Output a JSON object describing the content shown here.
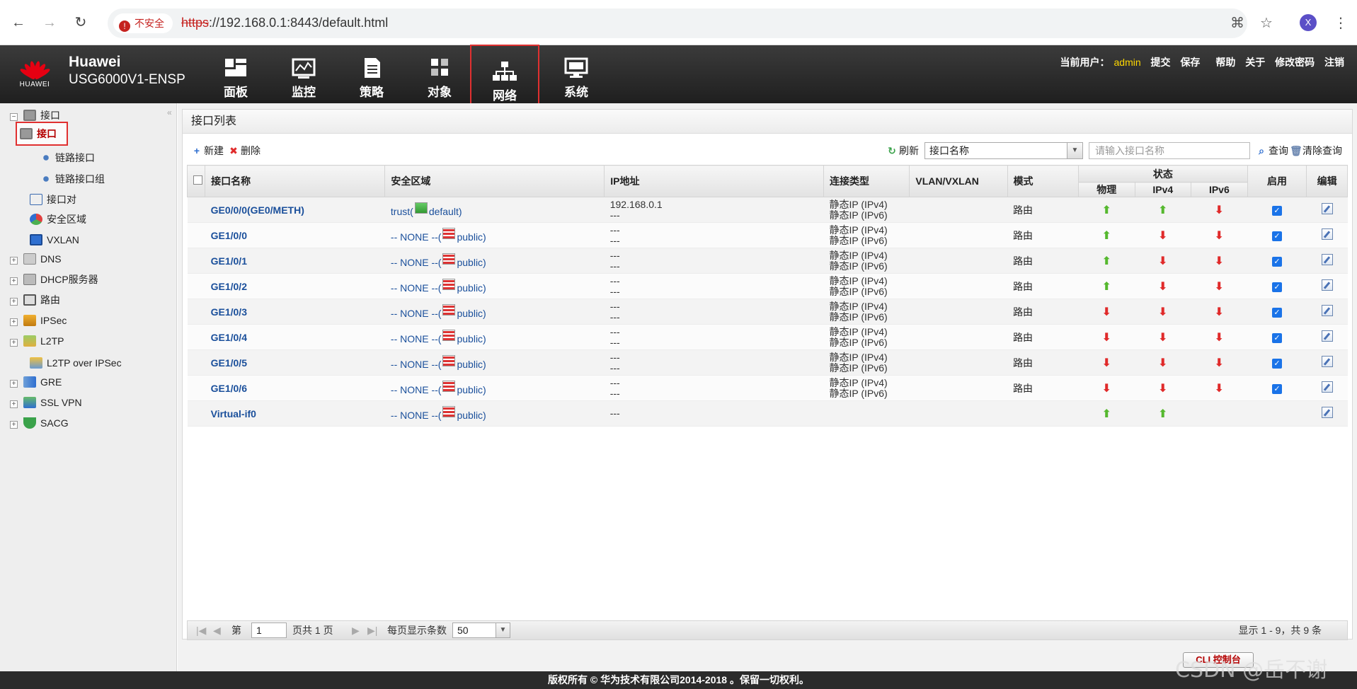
{
  "browser": {
    "insecure_label": "不安全",
    "url_scheme": "https",
    "url_rest": "://192.168.0.1:8443/default.html",
    "profile_initial": "X"
  },
  "header": {
    "brand": "HUAWEI",
    "product_line1": "Huawei",
    "product_line2": "USG6000V1-ENSP",
    "tabs": [
      {
        "label": "面板",
        "icon": "dashboard-icon"
      },
      {
        "label": "监控",
        "icon": "monitor-icon"
      },
      {
        "label": "策略",
        "icon": "policy-icon"
      },
      {
        "label": "对象",
        "icon": "object-icon"
      },
      {
        "label": "网络",
        "icon": "network-icon",
        "active": true
      },
      {
        "label": "系统",
        "icon": "system-icon"
      }
    ],
    "user_prefix": "当前用户：",
    "user_name": "admin",
    "links": [
      "提交",
      "保存",
      "帮助",
      "关于",
      "修改密码",
      "注销"
    ]
  },
  "sidebar": {
    "items": [
      {
        "label": "接口",
        "expander": "−",
        "icon": "interface-icon"
      },
      {
        "label": "接口",
        "icon": "interface-icon",
        "selected": true
      },
      {
        "label": "链路接口",
        "icon": "link-interface-icon"
      },
      {
        "label": "链路接口组",
        "icon": "link-group-icon"
      },
      {
        "label": "接口对",
        "icon": "interface-pair-icon"
      },
      {
        "label": "安全区域",
        "icon": "security-zone-icon"
      },
      {
        "label": "VXLAN",
        "icon": "vxlan-icon"
      },
      {
        "label": "DNS",
        "expander": "+",
        "icon": "dns-icon"
      },
      {
        "label": "DHCP服务器",
        "expander": "+",
        "icon": "dhcp-icon"
      },
      {
        "label": "路由",
        "expander": "+",
        "icon": "route-icon"
      },
      {
        "label": "IPSec",
        "expander": "+",
        "icon": "ipsec-icon"
      },
      {
        "label": "L2TP",
        "expander": "+",
        "icon": "l2tp-icon"
      },
      {
        "label": "L2TP over IPSec",
        "icon": "l2tp-ipsec-icon"
      },
      {
        "label": "GRE",
        "expander": "+",
        "icon": "gre-icon"
      },
      {
        "label": "SSL VPN",
        "expander": "+",
        "icon": "sslvpn-icon"
      },
      {
        "label": "SACG",
        "expander": "+",
        "icon": "sacg-icon"
      }
    ]
  },
  "panel": {
    "title": "接口列表",
    "toolbar": {
      "new": "新建",
      "delete": "删除",
      "refresh": "刷新",
      "field_select": "接口名称",
      "search_placeholder": "请输入接口名称",
      "query": "查询",
      "clear_query": "清除查询"
    },
    "columns": {
      "name": "接口名称",
      "zone": "安全区域",
      "ip": "IP地址",
      "conn": "连接类型",
      "vlan": "VLAN/VXLAN",
      "mode": "模式",
      "status": "状态",
      "physical": "物理",
      "ipv4": "IPv4",
      "ipv6": "IPv6",
      "enable": "启用",
      "edit": "编辑"
    },
    "rows": [
      {
        "name": "GE0/0/0(GE0/METH)",
        "zone_prefix": "trust(",
        "zone_suffix": "default)",
        "zone_icon": "green",
        "ip1": "192.168.0.1",
        "ip2": "---",
        "conn1": "静态IP (IPv4)",
        "conn2": "静态IP (IPv6)",
        "mode": "路由",
        "phy": "up",
        "v4": "up",
        "v6": "down",
        "enabled": true
      },
      {
        "name": "GE1/0/0",
        "zone_prefix": "-- NONE --(",
        "zone_suffix": "public)",
        "zone_icon": "red",
        "ip1": "---",
        "ip2": "---",
        "conn1": "静态IP (IPv4)",
        "conn2": "静态IP (IPv6)",
        "mode": "路由",
        "phy": "up",
        "v4": "down",
        "v6": "down",
        "enabled": true
      },
      {
        "name": "GE1/0/1",
        "zone_prefix": "-- NONE --(",
        "zone_suffix": "public)",
        "zone_icon": "red",
        "ip1": "---",
        "ip2": "---",
        "conn1": "静态IP (IPv4)",
        "conn2": "静态IP (IPv6)",
        "mode": "路由",
        "phy": "up",
        "v4": "down",
        "v6": "down",
        "enabled": true
      },
      {
        "name": "GE1/0/2",
        "zone_prefix": "-- NONE --(",
        "zone_suffix": "public)",
        "zone_icon": "red",
        "ip1": "---",
        "ip2": "---",
        "conn1": "静态IP (IPv4)",
        "conn2": "静态IP (IPv6)",
        "mode": "路由",
        "phy": "up",
        "v4": "down",
        "v6": "down",
        "enabled": true
      },
      {
        "name": "GE1/0/3",
        "zone_prefix": "-- NONE --(",
        "zone_suffix": "public)",
        "zone_icon": "red",
        "ip1": "---",
        "ip2": "---",
        "conn1": "静态IP (IPv4)",
        "conn2": "静态IP (IPv6)",
        "mode": "路由",
        "phy": "down",
        "v4": "down",
        "v6": "down",
        "enabled": true
      },
      {
        "name": "GE1/0/4",
        "zone_prefix": "-- NONE --(",
        "zone_suffix": "public)",
        "zone_icon": "red",
        "ip1": "---",
        "ip2": "---",
        "conn1": "静态IP (IPv4)",
        "conn2": "静态IP (IPv6)",
        "mode": "路由",
        "phy": "down",
        "v4": "down",
        "v6": "down",
        "enabled": true
      },
      {
        "name": "GE1/0/5",
        "zone_prefix": "-- NONE --(",
        "zone_suffix": "public)",
        "zone_icon": "red",
        "ip1": "---",
        "ip2": "---",
        "conn1": "静态IP (IPv4)",
        "conn2": "静态IP (IPv6)",
        "mode": "路由",
        "phy": "down",
        "v4": "down",
        "v6": "down",
        "enabled": true
      },
      {
        "name": "GE1/0/6",
        "zone_prefix": "-- NONE --(",
        "zone_suffix": "public)",
        "zone_icon": "red",
        "ip1": "---",
        "ip2": "---",
        "conn1": "静态IP (IPv4)",
        "conn2": "静态IP (IPv6)",
        "mode": "路由",
        "phy": "down",
        "v4": "down",
        "v6": "down",
        "enabled": true
      },
      {
        "name": "Virtual-if0",
        "zone_prefix": "-- NONE --(",
        "zone_suffix": "public)",
        "zone_icon": "red",
        "ip1": "---",
        "ip2": "",
        "conn1": "",
        "conn2": "",
        "mode": "",
        "phy": "up",
        "v4": "up",
        "v6": "",
        "enabled": null
      }
    ],
    "pager": {
      "page_prefix": "第",
      "page_value": "1",
      "page_suffix": "页共 1 页",
      "per_page_label": "每页显示条数",
      "per_page_value": "50",
      "info": "显示 1 - 9，共 9 条"
    },
    "cli_button": "CLI 控制台"
  },
  "footer": {
    "copyright": "版权所有 © 华为技术有限公司2014-2018 。保留一切权利。"
  },
  "watermark": "CSDN @岳不谢",
  "colors": {
    "accent_red": "#e03030",
    "status_up": "#55b82e",
    "status_down": "#e02a2a",
    "link_blue": "#1a4f9b",
    "username_yellow": "#ffd800"
  }
}
